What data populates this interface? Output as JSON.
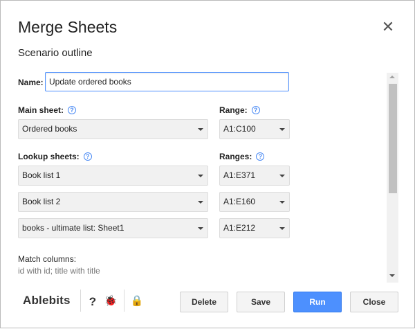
{
  "dialog": {
    "title": "Merge Sheets",
    "close_glyph": "✕",
    "subtitle": "Scenario outline"
  },
  "form": {
    "name_label": "Name:",
    "name_value": "Update ordered books",
    "main_sheet_label": "Main sheet:",
    "main_sheet_value": "Ordered books",
    "range_label": "Range:",
    "range_value": "A1:C100",
    "lookup_label": "Lookup sheets:",
    "ranges_label": "Ranges:",
    "lookup_sheets": [
      {
        "sheet": "Book list 1",
        "range": "A1:E371"
      },
      {
        "sheet": "Book list 2",
        "range": "A1:E160"
      },
      {
        "sheet": "books - ultimate list: Sheet1",
        "range": "A1:E212"
      }
    ],
    "match_label": "Match columns:",
    "match_value": "id with id; title with title",
    "help_glyph": "?"
  },
  "footer": {
    "brand": "Ablebits",
    "help_glyph": "?",
    "bug_glyph": "🐞",
    "privacy_glyph": "🔒",
    "buttons": {
      "delete": "Delete",
      "save": "Save",
      "run": "Run",
      "close": "Close"
    }
  },
  "icons": [
    "close-icon",
    "help-icon",
    "dropdown-arrow-icon",
    "bug-icon",
    "privacy-icon"
  ],
  "colors": {
    "accent": "#4d90fe",
    "help_icon": "#4a8af4"
  }
}
